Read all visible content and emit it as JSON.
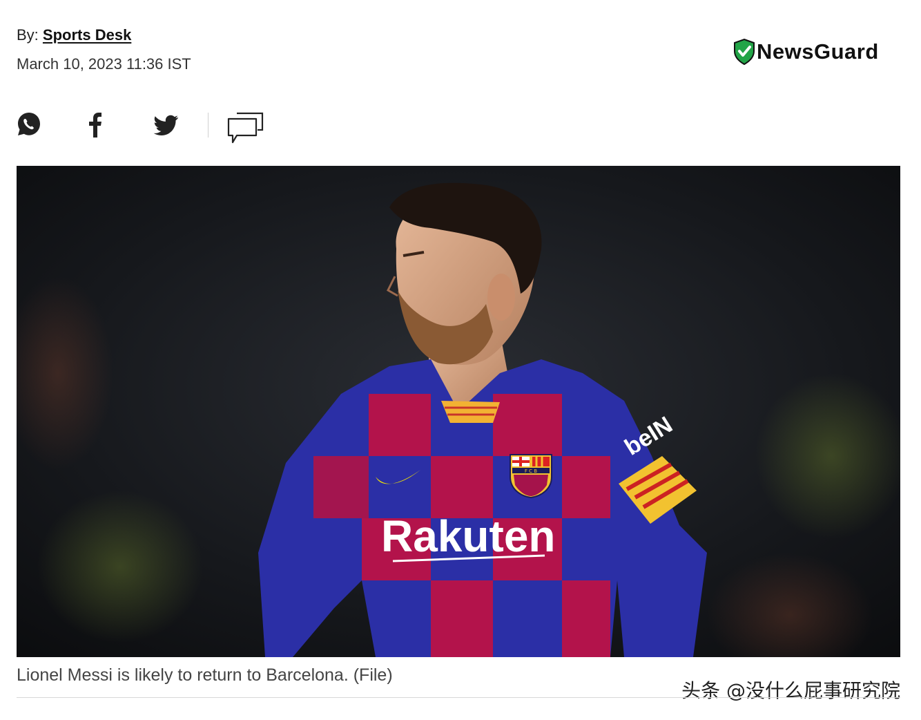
{
  "article": {
    "byline_prefix": "By:",
    "author": "Sports Desk",
    "datetime": "March 10, 2023 11:36 IST",
    "caption": "Lionel Messi is likely to return to Barcelona. (File)"
  },
  "badge": {
    "name": "NewsGuard",
    "icon": "shield-check-icon",
    "color": "#22a447"
  },
  "share": [
    {
      "name": "whatsapp",
      "icon": "whatsapp-icon"
    },
    {
      "name": "facebook",
      "icon": "facebook-icon"
    },
    {
      "name": "twitter",
      "icon": "twitter-icon"
    },
    {
      "name": "comments",
      "icon": "comments-icon"
    }
  ],
  "photo": {
    "shirt_sponsor": "Rakuten",
    "sleeve_sponsor": "beIN",
    "crest_text": "F C B"
  },
  "watermark": "头条 @没什么屁事研究院"
}
